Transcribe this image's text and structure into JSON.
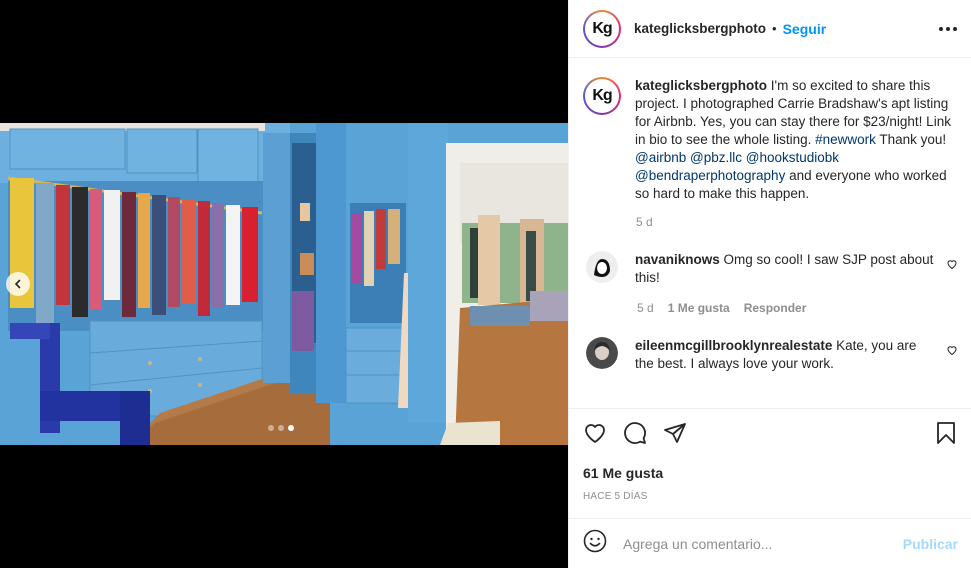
{
  "post": {
    "author": "kateglicksbergphoto",
    "avatar_text": "Kg",
    "follow_label": "Seguir",
    "caption_author": "kateglicksbergphoto",
    "caption_part1": "I'm so excited to share this project. I photographed Carrie Bradshaw's apt listing for Airbnb. Yes, you can stay there for $23/night! Link in bio to see the whole listing. ",
    "caption_tag": "#newwork",
    "caption_part2": " Thank you! ",
    "caption_mention1": "@airbnb",
    "caption_mention2": "@pbz.llc",
    "caption_mention3": "@hookstudiobk",
    "caption_mention4": "@bendraperphotography",
    "caption_part3": " and everyone who worked so hard to make this happen.",
    "caption_age": "5 d",
    "likes": "61 Me gusta",
    "posted_ago": "Hace 5 días"
  },
  "comments": [
    {
      "user": "navaniknows",
      "text": "Omg so cool! I saw SJP post about this!",
      "age": "5 d",
      "likes": "1 Me gusta",
      "reply_label": "Responder"
    },
    {
      "user": "eileenmcgillbrooklynrealestate",
      "text": "Kate, you are the best. I always love your work."
    }
  ],
  "composer": {
    "placeholder": "Agrega un comentario...",
    "publish_label": "Publicar"
  },
  "carousel": {
    "total": 3,
    "current": 3
  },
  "colors": {
    "accent": "#0095f6",
    "link": "#00376b",
    "muted": "#8e8e8e"
  }
}
